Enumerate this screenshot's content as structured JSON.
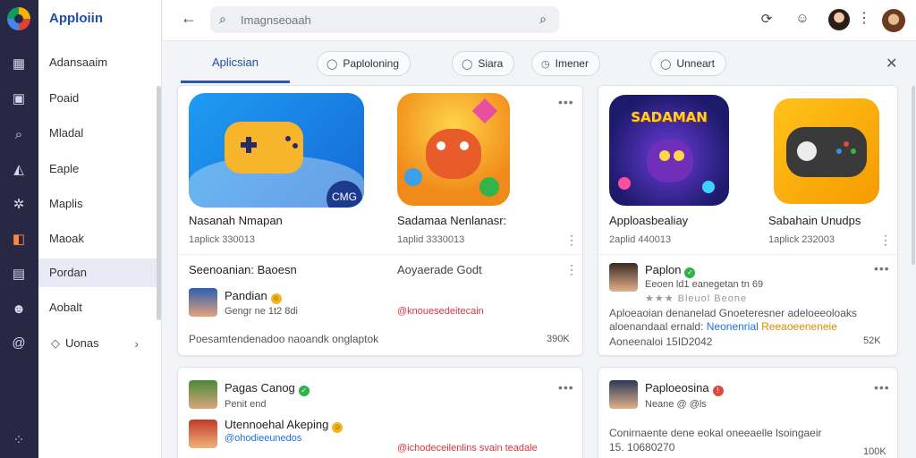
{
  "app": {
    "brand": "Apploiin"
  },
  "sidebar": {
    "items": [
      {
        "label": "Adansaaim"
      },
      {
        "label": "Poaid"
      },
      {
        "label": "Mladal"
      },
      {
        "label": "Eaple"
      },
      {
        "label": "Maplis"
      },
      {
        "label": "Maoak"
      },
      {
        "label": "Pordan"
      },
      {
        "label": "Aobalt"
      },
      {
        "label": "Uonas"
      }
    ]
  },
  "search": {
    "placeholder": "Imagnseoaah"
  },
  "tabs": {
    "active": "Aplicsian",
    "chips": [
      {
        "label": "Paploloning",
        "icon": "◯"
      },
      {
        "label": "Siara",
        "icon": "◯"
      },
      {
        "label": "Imener",
        "icon": "◷"
      },
      {
        "label": "Unneart",
        "icon": "◯"
      }
    ]
  },
  "cards": {
    "top_left": {
      "game1": {
        "name": "Nasanah Nmapan",
        "meta": "1aplick 330013",
        "tile_text": "CMG"
      },
      "game2": {
        "name": "Sadamaa Nenlanasr:",
        "meta": "1aplid 3330013"
      },
      "review": {
        "heading1": "Seenoanian: Baoesn",
        "heading2": "Aoyaerade Godt",
        "user": "Pandian",
        "user_sub": "Gengr ne 1t2 8di",
        "link": "@knouesedeitecain",
        "footer": "Poesamtendenadoo naoandk onglaptok",
        "count": "390K"
      }
    },
    "top_right": {
      "game1": {
        "name": "Apploasbealiay",
        "meta": "2aplid 440013",
        "tile_text": "SADAMAN"
      },
      "game2": {
        "name": "Sabahain Unudps",
        "meta": "1aplick 232003"
      },
      "review": {
        "user": "Paplon",
        "user_sub": "Eeoen ld1 eanegetan tn 69",
        "rating_text": "★★★ Bleuol Beone",
        "body": "Aploeaoian denanelad Gnoeteresner adeloeeoloaks",
        "body2_a": "aloenandaal ernald:",
        "body2_b": "Neonenrial",
        "body2_c": "Reeaoeeneneie",
        "footer": "Aoneenaloi 15ID2042",
        "count": "52K"
      }
    },
    "bottom_left": {
      "user1": "Pagas Canog",
      "user1_sub": "Penit end",
      "user2": "Utennoehal Akeping",
      "user2_sub": "@ohodieeunedos",
      "link": "@ichodeceilenlins svain teadale"
    },
    "bottom_right": {
      "user": "Paploeosina",
      "user_sub": "Neane @ @ls",
      "body": "Conirnaente dene eokal oneeaelle lsoingaeir",
      "body2": "15. 10680270",
      "count": "100K"
    }
  },
  "colors": {
    "accent": "#2457b8",
    "rail": "#282845",
    "link_red": "#d8363f",
    "link_blue": "#1a73e8",
    "link_orange": "#e08a00"
  }
}
